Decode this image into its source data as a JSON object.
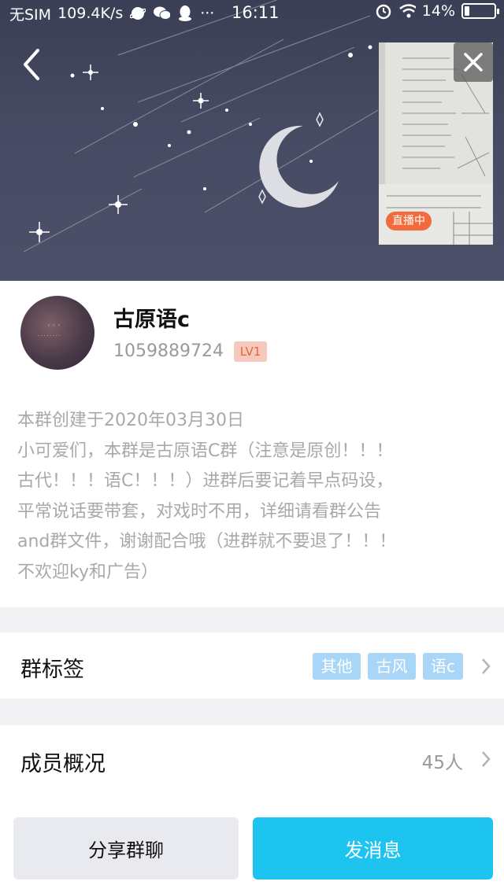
{
  "status_bar": {
    "carrier": "无SIM",
    "speed": "109.4K/s",
    "dots": "···",
    "time": "16:11",
    "battery": "14%"
  },
  "live": {
    "badge": "直播中"
  },
  "group": {
    "name": "古原语c",
    "id": "1059889724",
    "level": "LV1"
  },
  "description": {
    "created": "本群创建于2020年03月30日",
    "lines": [
      "小可爱们，本群是古原语C群（注意是原创！！！",
      "古代！！！语C！！！）进群后要记着早点码设，",
      "平常说话要带套，对戏时不用，详细请看群公告",
      "and群文件，谢谢配合哦（进群就不要退了！！！",
      "不欢迎ky和广告）"
    ]
  },
  "tags_row": {
    "label": "群标签",
    "tags": [
      "其他",
      "古风",
      "语c"
    ]
  },
  "members_row": {
    "label": "成员概况",
    "count": "45人"
  },
  "actions": {
    "share": "分享群聊",
    "send": "发消息"
  },
  "colors": {
    "accent": "#1ec4f0",
    "tag_bg": "#a9d6f7",
    "live_badge": "#f36a3c",
    "level_badge_bg": "#f6c9bd",
    "level_badge_text": "#e4653f"
  }
}
